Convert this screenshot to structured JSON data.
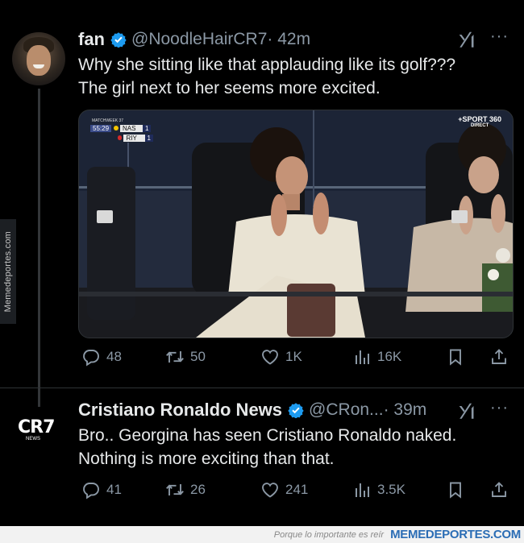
{
  "watermark": {
    "side": "Memedeportes.com"
  },
  "tweets": [
    {
      "name": "fan",
      "handle": "@NoodleHairCR7",
      "time": "· 42m",
      "text_lines": [
        "Why she sitting like that applauding like its golf???",
        "The girl next to her seems more excited."
      ],
      "media": {
        "scoreboard": {
          "league": "MATCHWEEK 37",
          "clock": "55:29",
          "home_team": "NAS",
          "home_score": "1",
          "away_team": "RIY",
          "away_score": "1"
        },
        "broadcaster": {
          "brand": "+SPORT 360",
          "status": "DIRECT"
        }
      },
      "stats": {
        "replies": "48",
        "retweets": "50",
        "likes": "1K",
        "views": "16K"
      }
    },
    {
      "name": "Cristiano Ronaldo News",
      "handle": "@CRon...",
      "time": "· 39m",
      "avatar_text": "CR7",
      "avatar_subtext": "NEWS",
      "text_lines": [
        "Bro.. Georgina has seen Cristiano Ronaldo naked.",
        "Nothing is more exciting than that."
      ],
      "stats": {
        "replies": "41",
        "retweets": "26",
        "likes": "241",
        "views": "3.5K"
      }
    }
  ],
  "footer": {
    "tagline": "Porque lo importante es reír",
    "site": "MEMEDEPORTES.COM"
  },
  "icons": {
    "verified": "verified-badge-icon",
    "grok": "grok-icon",
    "more": "more-icon",
    "reply": "reply-icon",
    "retweet": "retweet-icon",
    "like": "like-icon",
    "views": "views-icon",
    "bookmark": "bookmark-icon",
    "share": "share-icon"
  },
  "colors": {
    "background": "#000000",
    "text": "#e7e9ea",
    "muted": "#8b98a5",
    "verified": "#1d9bf0"
  }
}
